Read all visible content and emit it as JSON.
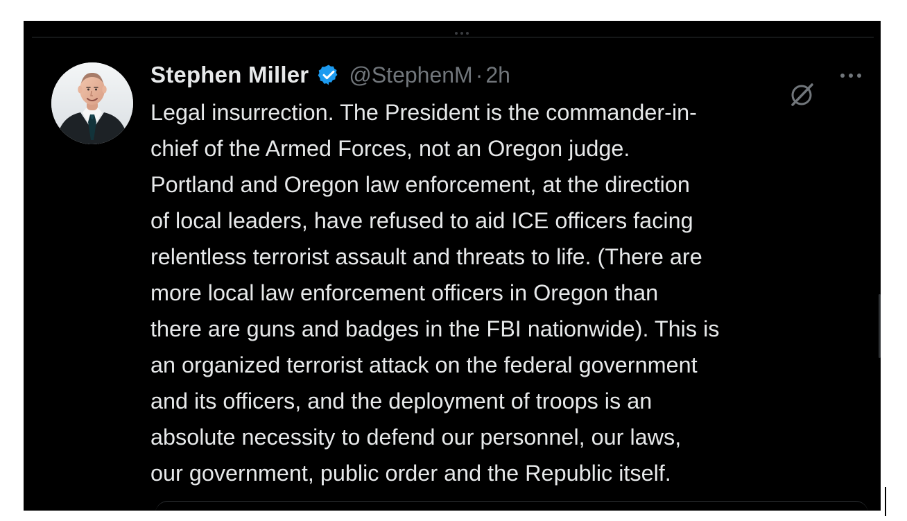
{
  "tweet": {
    "display_name": "Stephen Miller",
    "handle": "@StephenM",
    "separator": "·",
    "time": "2h",
    "verified_icon": "verified-badge-icon",
    "lines": [
      "Legal insurrection. The President is the commander-in-",
      "chief of the Armed Forces, not an Oregon judge.",
      "Portland and Oregon law enforcement, at the direction",
      "of local leaders, have refused to aid ICE officers facing",
      "relentless terrorist assault and threats to life. (There are",
      "more local law enforcement officers in Oregon than",
      "there are guns and badges in the FBI nationwide). This is",
      "an organized terrorist attack on the federal government",
      "and its officers, and the deployment of troops is an",
      "absolute necessity to defend our personnel, our laws,",
      "our government, public order and the Republic itself."
    ]
  },
  "icons": {
    "grok": "grok-icon",
    "more": "more-options-icon",
    "avatar": "profile-avatar"
  },
  "colors": {
    "background": "#000000",
    "text_primary": "#e7e9ea",
    "text_secondary": "#71767b",
    "verified_blue": "#1d9bf0"
  }
}
